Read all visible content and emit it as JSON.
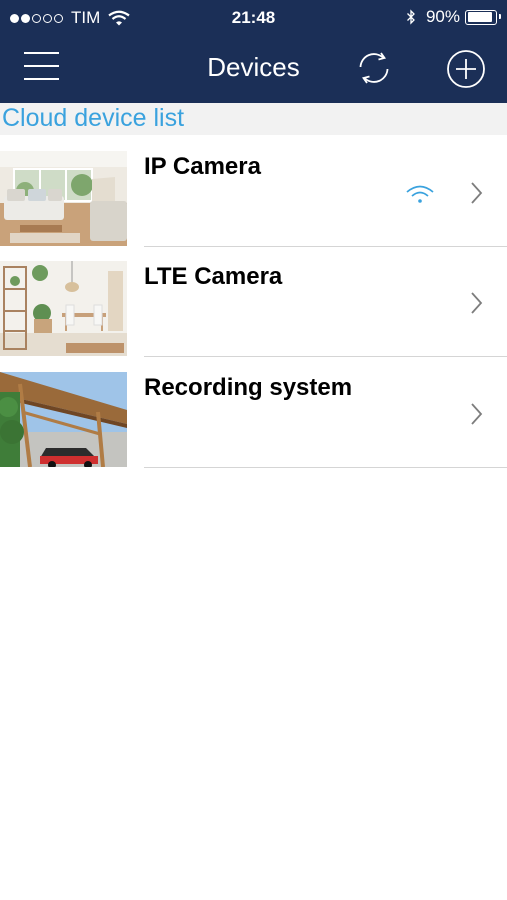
{
  "status_bar": {
    "carrier": "TIM",
    "time": "21:48",
    "battery_percent": "90%",
    "battery_level": 0.9,
    "signal_bars_filled": 2,
    "signal_bars_total": 5
  },
  "header": {
    "title": "Devices",
    "menu_icon": "hamburger-menu-icon",
    "sync_icon": "refresh-icon",
    "add_icon": "plus-circle-icon"
  },
  "section": {
    "title": "Cloud device list"
  },
  "devices": [
    {
      "name": "IP Camera",
      "thumbnail": "living-room-photo",
      "wifi_connected": true
    },
    {
      "name": "LTE Camera",
      "thumbnail": "dining-room-photo",
      "wifi_connected": false
    },
    {
      "name": "Recording system",
      "thumbnail": "carport-photo",
      "wifi_connected": false
    }
  ],
  "colors": {
    "header_bg": "#1b2f57",
    "accent": "#3aa2de",
    "section_bg": "#f2f2f2"
  }
}
